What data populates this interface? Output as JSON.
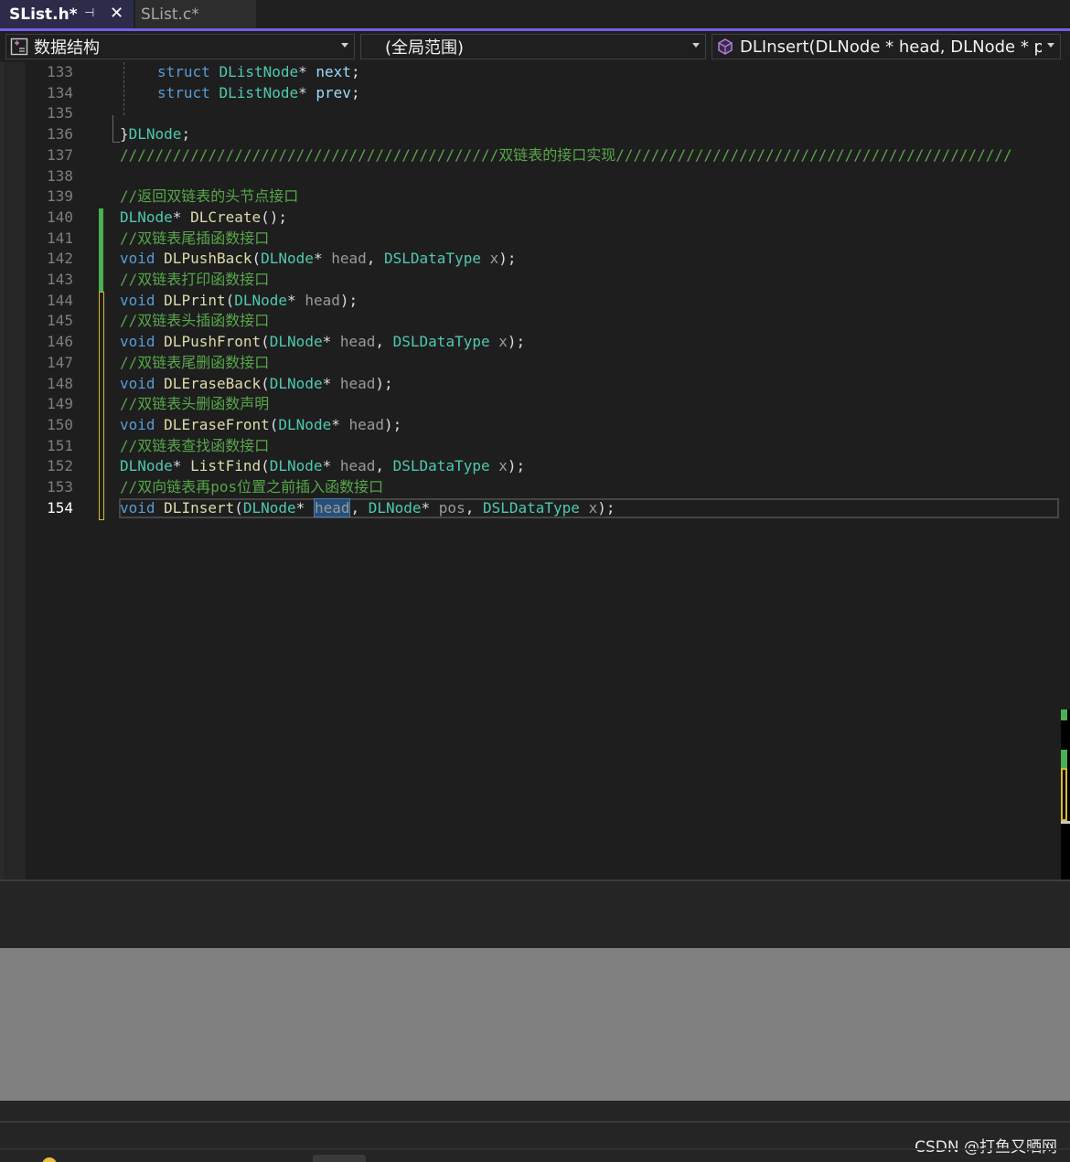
{
  "tabs": [
    {
      "label": "SList.h*",
      "active": true
    },
    {
      "label": "SList.c*",
      "active": false
    }
  ],
  "tab_icons": {
    "pin": "⊣",
    "close": "✕"
  },
  "navbar": {
    "project": "数据结构",
    "scope": "(全局范围)",
    "member": "DLInsert(DLNode * head, DLNode * pos, DSLDataType x)"
  },
  "editor": {
    "current_line": 154,
    "lines": [
      {
        "n": 133,
        "tokens": [
          {
            "t": "struct",
            "c": "kw"
          },
          {
            "t": " "
          },
          {
            "t": "DListNode",
            "c": "ty"
          },
          {
            "t": "* "
          },
          {
            "t": "next",
            "c": "vr"
          },
          {
            "t": ";"
          }
        ],
        "indent": true
      },
      {
        "n": 134,
        "tokens": [
          {
            "t": "struct",
            "c": "kw"
          },
          {
            "t": " "
          },
          {
            "t": "DListNode",
            "c": "ty"
          },
          {
            "t": "* "
          },
          {
            "t": "prev",
            "c": "vr"
          },
          {
            "t": ";"
          }
        ],
        "indent": true
      },
      {
        "n": 135,
        "tokens": []
      },
      {
        "n": 136,
        "tokens": [
          {
            "t": "}"
          },
          {
            "t": "DLNode",
            "c": "ty"
          },
          {
            "t": ";"
          }
        ]
      },
      {
        "n": 137,
        "tokens": [
          {
            "t": "///////////////////////////////////////////双链表的接口实现/////////////////////////////////////////////",
            "c": "cm"
          }
        ]
      },
      {
        "n": 138,
        "tokens": []
      },
      {
        "n": 139,
        "tokens": [
          {
            "t": "//返回双链表的头节点接口",
            "c": "cm"
          }
        ]
      },
      {
        "n": 140,
        "tokens": [
          {
            "t": "DLNode",
            "c": "ty"
          },
          {
            "t": "* "
          },
          {
            "t": "DLCreate",
            "c": "fn"
          },
          {
            "t": "();"
          }
        ]
      },
      {
        "n": 141,
        "tokens": [
          {
            "t": "//双链表尾插函数接口",
            "c": "cm"
          }
        ]
      },
      {
        "n": 142,
        "tokens": [
          {
            "t": "void",
            "c": "kw"
          },
          {
            "t": " "
          },
          {
            "t": "DLPushBack",
            "c": "fn"
          },
          {
            "t": "("
          },
          {
            "t": "DLNode",
            "c": "ty"
          },
          {
            "t": "* "
          },
          {
            "t": "head",
            "c": "pm"
          },
          {
            "t": ", "
          },
          {
            "t": "DSLDataType",
            "c": "ty"
          },
          {
            "t": " "
          },
          {
            "t": "x",
            "c": "pm"
          },
          {
            "t": ");"
          }
        ]
      },
      {
        "n": 143,
        "tokens": [
          {
            "t": "//双链表打印函数接口",
            "c": "cm"
          }
        ]
      },
      {
        "n": 144,
        "tokens": [
          {
            "t": "void",
            "c": "kw"
          },
          {
            "t": " "
          },
          {
            "t": "DLPrint",
            "c": "fn"
          },
          {
            "t": "("
          },
          {
            "t": "DLNode",
            "c": "ty"
          },
          {
            "t": "* "
          },
          {
            "t": "head",
            "c": "pm"
          },
          {
            "t": ");"
          }
        ]
      },
      {
        "n": 145,
        "tokens": [
          {
            "t": "//双链表头插函数接口",
            "c": "cm"
          }
        ]
      },
      {
        "n": 146,
        "tokens": [
          {
            "t": "void",
            "c": "kw"
          },
          {
            "t": " "
          },
          {
            "t": "DLPushFront",
            "c": "fn"
          },
          {
            "t": "("
          },
          {
            "t": "DLNode",
            "c": "ty"
          },
          {
            "t": "* "
          },
          {
            "t": "head",
            "c": "pm"
          },
          {
            "t": ", "
          },
          {
            "t": "DSLDataType",
            "c": "ty"
          },
          {
            "t": " "
          },
          {
            "t": "x",
            "c": "pm"
          },
          {
            "t": ");"
          }
        ]
      },
      {
        "n": 147,
        "tokens": [
          {
            "t": "//双链表尾删函数接口",
            "c": "cm"
          }
        ]
      },
      {
        "n": 148,
        "tokens": [
          {
            "t": "void",
            "c": "kw"
          },
          {
            "t": " "
          },
          {
            "t": "DLEraseBack",
            "c": "fn"
          },
          {
            "t": "("
          },
          {
            "t": "DLNode",
            "c": "ty"
          },
          {
            "t": "* "
          },
          {
            "t": "head",
            "c": "pm"
          },
          {
            "t": ");"
          }
        ]
      },
      {
        "n": 149,
        "tokens": [
          {
            "t": "//双链表头删函数声明",
            "c": "cm"
          }
        ]
      },
      {
        "n": 150,
        "tokens": [
          {
            "t": "void",
            "c": "kw"
          },
          {
            "t": " "
          },
          {
            "t": "DLEraseFront",
            "c": "fn"
          },
          {
            "t": "("
          },
          {
            "t": "DLNode",
            "c": "ty"
          },
          {
            "t": "* "
          },
          {
            "t": "head",
            "c": "pm"
          },
          {
            "t": ");"
          }
        ]
      },
      {
        "n": 151,
        "tokens": [
          {
            "t": "//双链表查找函数接口",
            "c": "cm"
          }
        ]
      },
      {
        "n": 152,
        "tokens": [
          {
            "t": "DLNode",
            "c": "ty"
          },
          {
            "t": "* "
          },
          {
            "t": "ListFind",
            "c": "fn"
          },
          {
            "t": "("
          },
          {
            "t": "DLNode",
            "c": "ty"
          },
          {
            "t": "* "
          },
          {
            "t": "head",
            "c": "pm"
          },
          {
            "t": ", "
          },
          {
            "t": "DSLDataType",
            "c": "ty"
          },
          {
            "t": " "
          },
          {
            "t": "x",
            "c": "pm"
          },
          {
            "t": ");"
          }
        ]
      },
      {
        "n": 153,
        "tokens": [
          {
            "t": "//双向链表再pos位置之前插入函数接口",
            "c": "cm"
          }
        ]
      },
      {
        "n": 154,
        "tokens": [
          {
            "t": "void",
            "c": "kw"
          },
          {
            "t": " "
          },
          {
            "t": "DLInsert",
            "c": "fn"
          },
          {
            "t": "("
          },
          {
            "t": "DLNode",
            "c": "ty"
          },
          {
            "t": "* "
          },
          {
            "t": "head",
            "c": "sel"
          },
          {
            "t": ", "
          },
          {
            "t": "DLNode",
            "c": "ty"
          },
          {
            "t": "* "
          },
          {
            "t": "pos",
            "c": "pm"
          },
          {
            "t": ", "
          },
          {
            "t": "DSLDataType",
            "c": "ty"
          },
          {
            "t": " "
          },
          {
            "t": "x",
            "c": "pm"
          },
          {
            "t": ");"
          }
        ]
      }
    ]
  },
  "watermark": "CSDN @打鱼又晒网",
  "colors": {
    "keyword": "#569cd6",
    "type": "#4ec9b0",
    "function": "#dcdcaa",
    "field": "#9cdcfe",
    "parameter": "#9a9a9a",
    "comment": "#57a64a",
    "tab_accent": "#7160e8",
    "change_saved": "#4caf50",
    "change_unsaved": "#d7ba31"
  }
}
